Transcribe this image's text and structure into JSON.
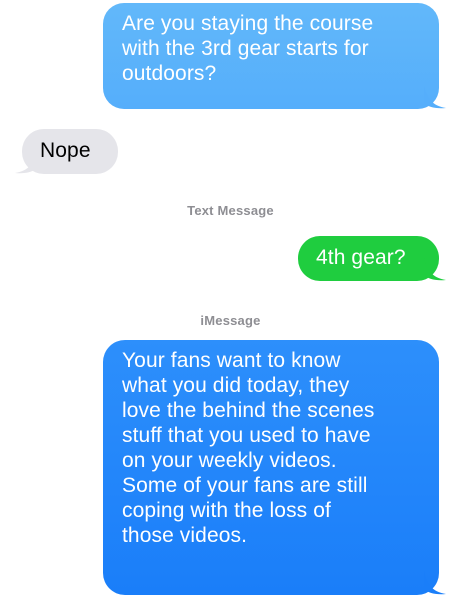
{
  "conversation": {
    "messages": [
      {
        "direction": "sent",
        "service": "iMessage",
        "text": "Are you staying the course\nwith the 3rd gear starts for\noutdoors?",
        "color": "#5ab2fa"
      },
      {
        "direction": "received",
        "text": "Nope",
        "color": "#e5e5ea"
      },
      {
        "direction": "sent",
        "service": "Text Message",
        "text": "4th gear?",
        "color": "#1fcd3f"
      },
      {
        "direction": "sent",
        "service": "iMessage",
        "text": "Your fans want to know\nwhat you did today, they\nlove the behind the scenes\nstuff that you used to have\non your weekly videos.\nSome of your fans are still\ncoping with the loss of\nthose videos.",
        "color": "#2386fa"
      }
    ],
    "service_labels": [
      "Text Message",
      "iMessage"
    ]
  }
}
